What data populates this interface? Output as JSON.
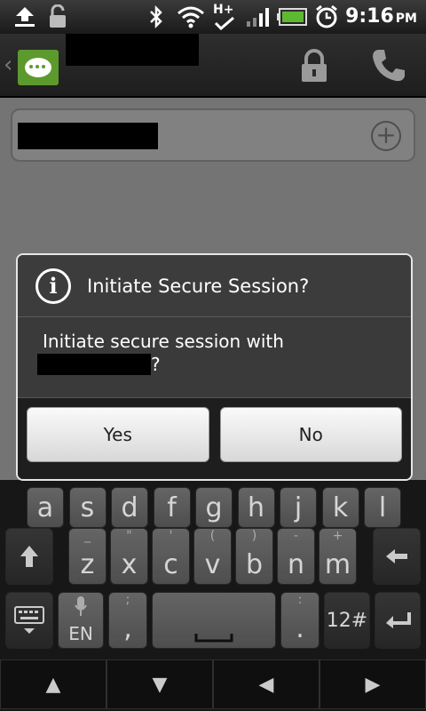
{
  "status_bar": {
    "time": "9:16",
    "ampm": "PM",
    "network_label": "H+",
    "icons": [
      "upload-icon",
      "unlock-icon",
      "bluetooth-icon",
      "wifi-icon",
      "network-h-plus-icon",
      "signal-icon",
      "battery-icon",
      "alarm-icon"
    ]
  },
  "title_bar": {
    "icons": [
      "back-chevron-icon",
      "messaging-app-icon",
      "lock-icon",
      "phone-icon"
    ]
  },
  "compose": {
    "add_contact_symbol": "+"
  },
  "dialog": {
    "title": "Initiate Secure Session?",
    "info_symbol": "i",
    "body_line1": "Initiate secure session with",
    "body_suffix": "?",
    "yes_label": "Yes",
    "no_label": "No"
  },
  "keyboard": {
    "row1": [
      "a",
      "s",
      "d",
      "f",
      "g",
      "h",
      "j",
      "k",
      "l"
    ],
    "row2": [
      {
        "key": "z",
        "sub": "_"
      },
      {
        "key": "x",
        "sub": "\""
      },
      {
        "key": "c",
        "sub": "'"
      },
      {
        "key": "v",
        "sub": "("
      },
      {
        "key": "b",
        "sub": ")"
      },
      {
        "key": "n",
        "sub": "-"
      },
      {
        "key": "m",
        "sub": "+"
      }
    ],
    "lang_label": "EN",
    "comma_key": ",",
    "comma_sub": ";",
    "period_key": ".",
    "period_sub": ":",
    "symbols_label": "12#"
  }
}
